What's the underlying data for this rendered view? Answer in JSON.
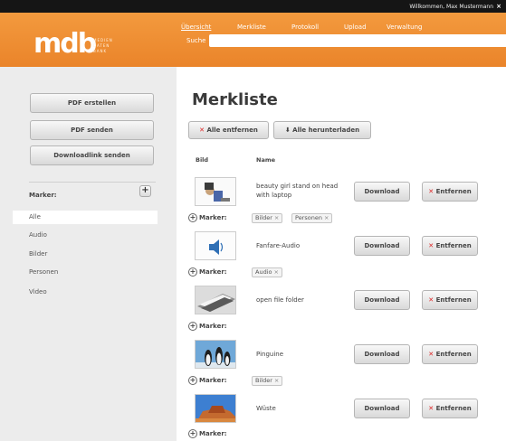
{
  "topbar": {
    "welcome": "Willkommen, Max Mustermann",
    "close": "×"
  },
  "header": {
    "logo_text": "mdb",
    "logo_sub": "MEDIEN DATEN BANK",
    "nav": [
      "Übersicht",
      "Merkliste",
      "Protokoll",
      "Upload",
      "Verwaltung"
    ],
    "search_label": "Suche"
  },
  "sidebar": {
    "buttons": [
      "PDF erstellen",
      "PDF senden",
      "Downloadlink senden"
    ],
    "marker_title": "Marker:",
    "markers": [
      "Alle",
      "Audio",
      "Bilder",
      "Personen",
      "Video"
    ],
    "selected_marker": "Alle"
  },
  "main": {
    "title": "Merkliste",
    "remove_all": "Alle entfernen",
    "download_all": "Alle herunterladen",
    "col_bild": "Bild",
    "col_name": "Name",
    "download_label": "Download",
    "remove_label": "Entfernen",
    "marker_label": "Marker:",
    "rows": [
      {
        "name": "beauty girl stand on head with laptop",
        "tags": [
          "Bilder",
          "Personen"
        ]
      },
      {
        "name": "Fanfare-Audio",
        "tags": [
          "Audio"
        ]
      },
      {
        "name": "open file folder",
        "tags": []
      },
      {
        "name": "Pinguine",
        "tags": [
          "Bilder"
        ]
      },
      {
        "name": "Wüste",
        "tags": []
      }
    ]
  },
  "colors": {
    "accent": "#ea842a",
    "topbar": "#151515",
    "remove": "#dd2222"
  }
}
